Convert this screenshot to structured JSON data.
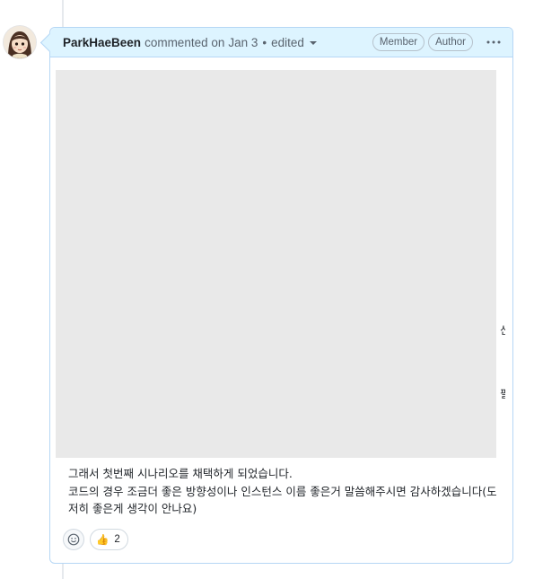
{
  "comment": {
    "author": "ParkHaeBeen",
    "action": "commented on",
    "date": "Jan 3",
    "separator": "•",
    "edited_label": "edited",
    "badges": [
      "Member",
      "Author"
    ],
    "avatar_icon": "avatar-girl-illustration",
    "more_icon": "kebab-horizontal-icon",
    "image_alt": "",
    "edge_glyphs": [
      "신",
      "필"
    ],
    "body_lines": [
      "그래서 첫번째 시나리오를 채택하게 되었습니다.",
      "코드의 경우 조금더 좋은 방향성이나 인스턴스 이름 좋은거 말씀해주시면 감사하겠습니다(도저히 좋은게 생각이 안나요)"
    ],
    "reactions": [
      {
        "icon": "thumbs-up",
        "emoji": "👍",
        "count": "2"
      }
    ],
    "emoji_picker_icon": "smiley-icon"
  },
  "colors": {
    "header_bg": "#ddf4ff",
    "border": "#b6d7f5",
    "placeholder": "#e9e9e9"
  }
}
